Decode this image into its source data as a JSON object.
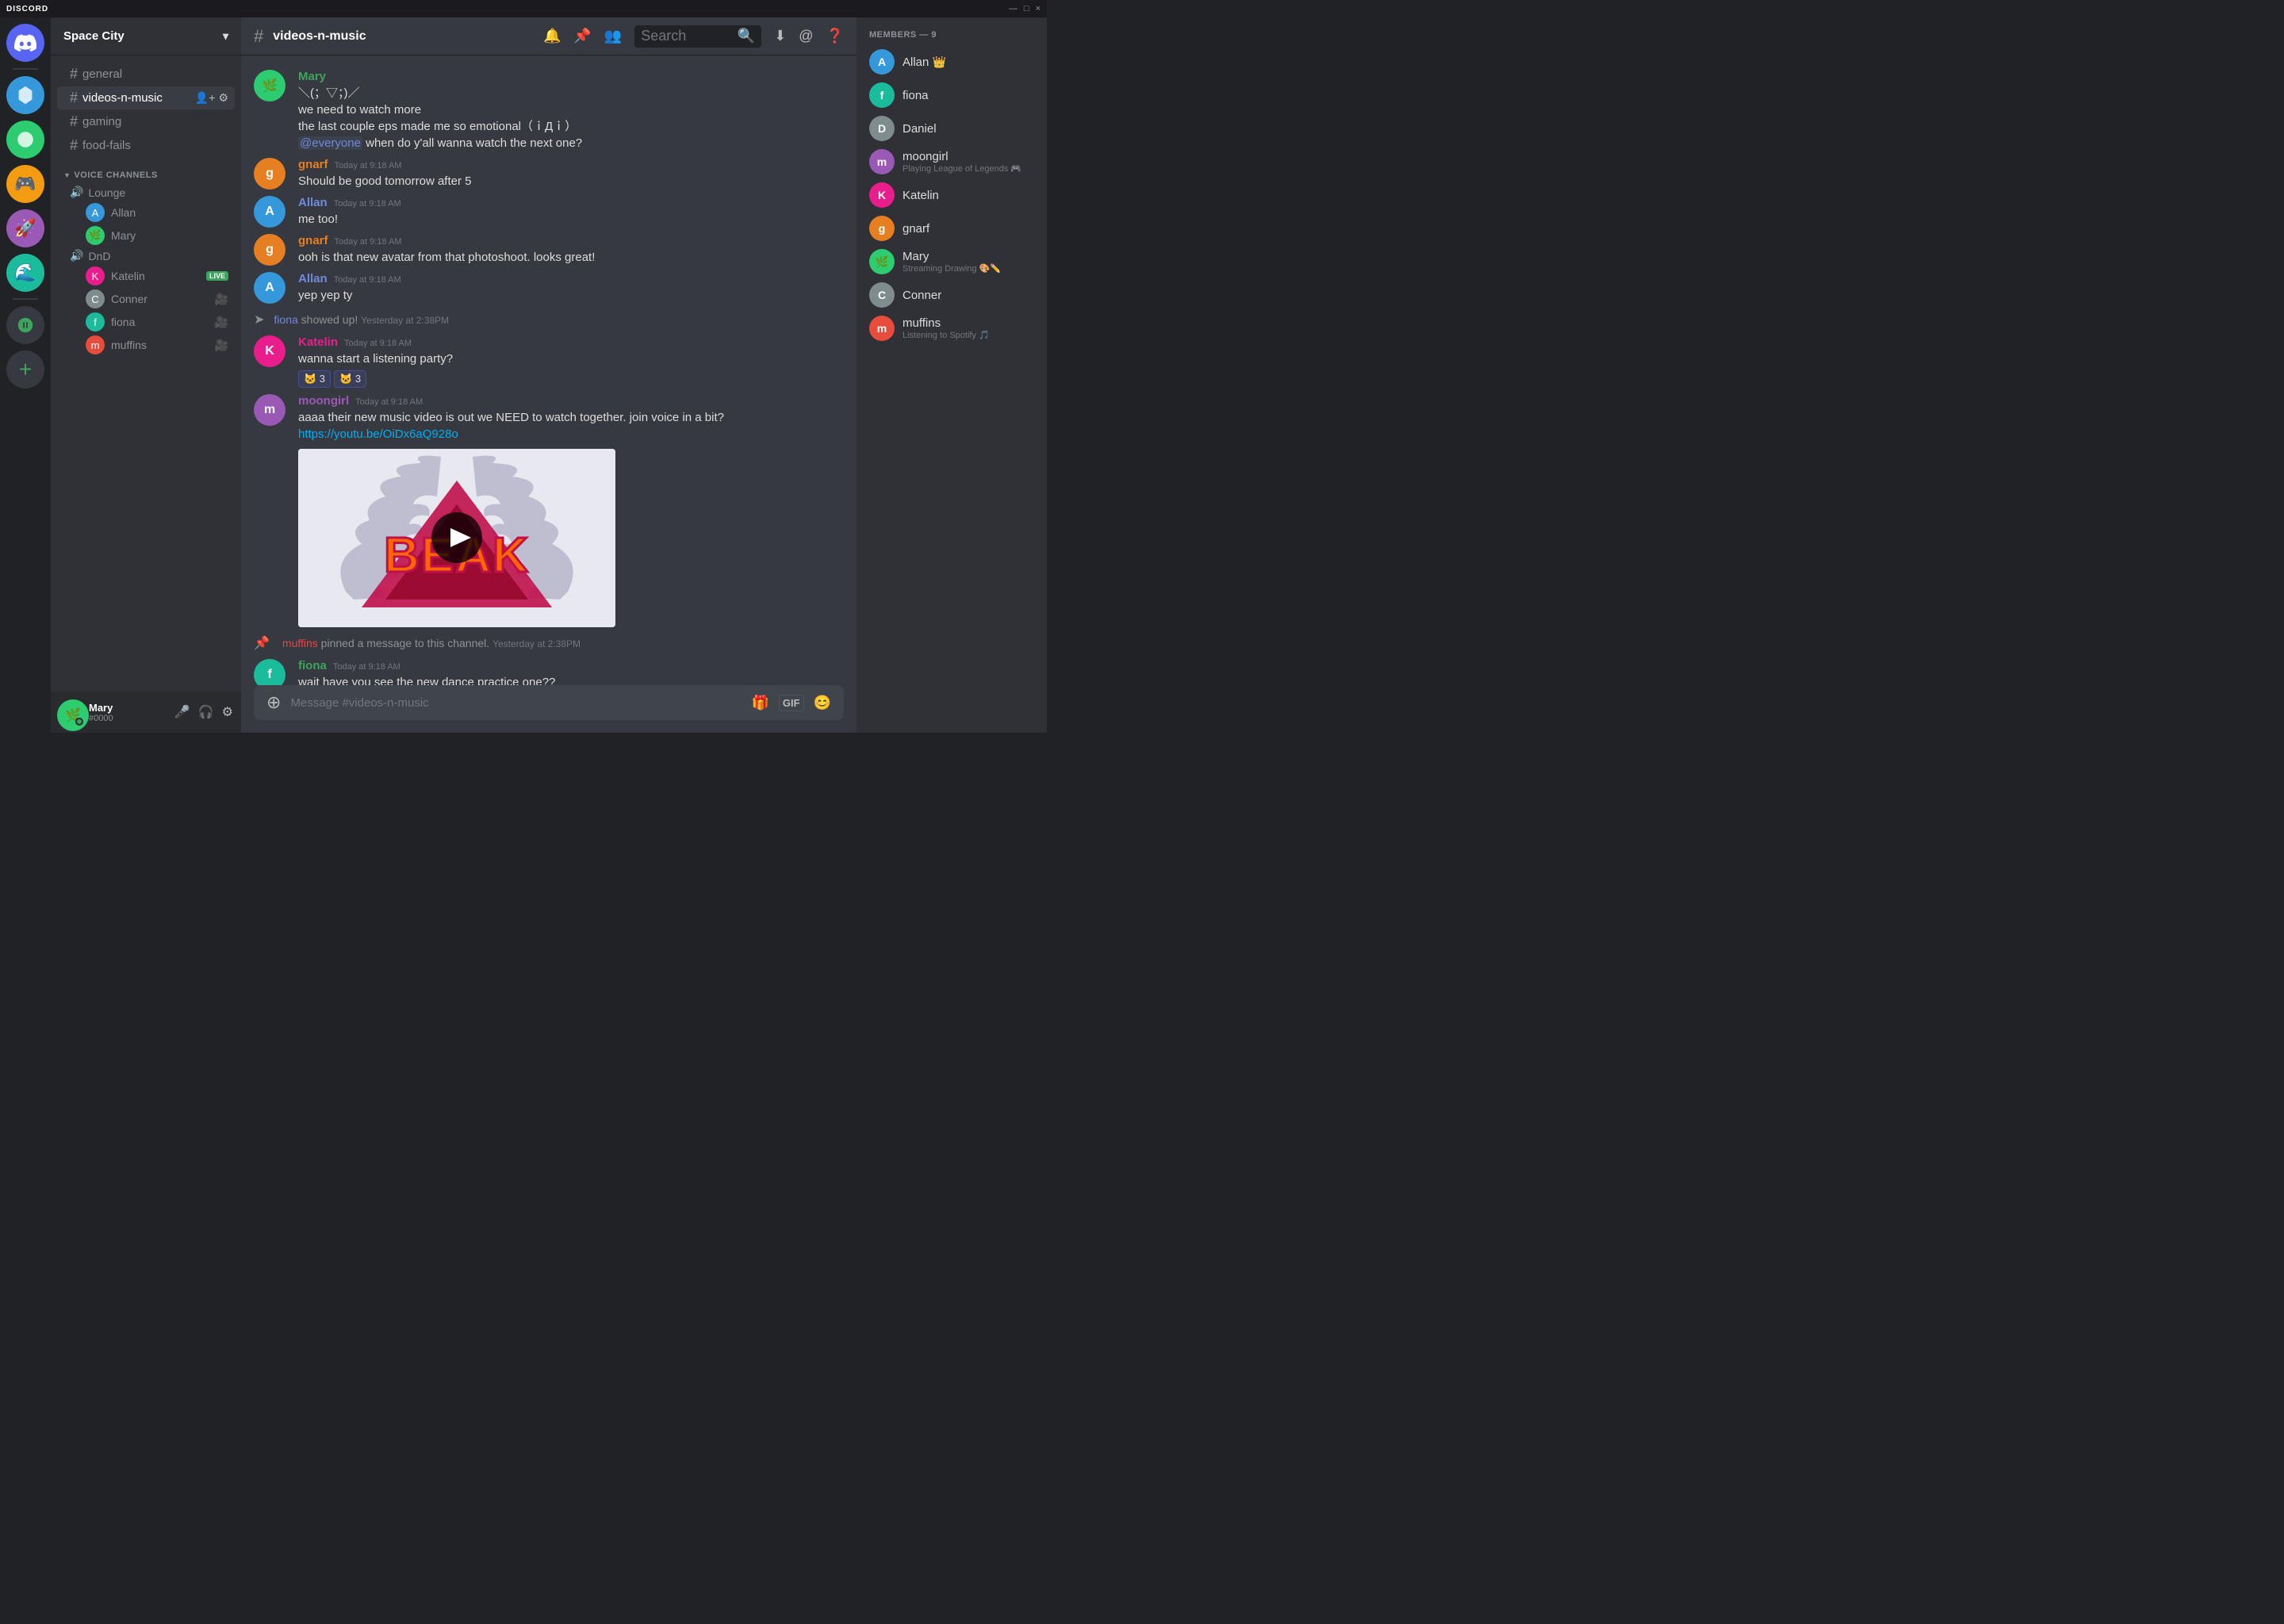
{
  "titlebar": {
    "logo": "DISCORD",
    "controls": [
      "—",
      "□",
      "×"
    ]
  },
  "server": {
    "name": "Space City",
    "channels": [
      {
        "type": "text",
        "name": "general",
        "active": false
      },
      {
        "type": "text",
        "name": "videos-n-music",
        "active": true
      },
      {
        "type": "text",
        "name": "gaming",
        "active": false
      },
      {
        "type": "text",
        "name": "food-fails",
        "active": false
      }
    ],
    "voice": {
      "label": "Voice Channels",
      "groups": [
        {
          "name": "Lounge",
          "users": [
            {
              "name": "Allan",
              "color": "av-blue"
            },
            {
              "name": "Mary",
              "color": "av-green"
            }
          ]
        },
        {
          "name": "DnD",
          "users": [
            {
              "name": "Katelin",
              "live": true,
              "color": "av-pink"
            },
            {
              "name": "Conner",
              "video": true,
              "color": "av-grey"
            },
            {
              "name": "fiona",
              "video": true,
              "color": "av-teal"
            },
            {
              "name": "muffins",
              "video": true,
              "color": "av-red"
            }
          ]
        }
      ]
    }
  },
  "currentChannel": "videos-n-music",
  "search": {
    "placeholder": "Search"
  },
  "messages": [
    {
      "id": "msg1",
      "author": "Mary",
      "authorColor": "msg-fiona",
      "avatarColor": "av-green",
      "avatarEmoji": "🌿",
      "showAvatar": true,
      "lines": [
        "＼(；▽；)／",
        "we need to watch more",
        "the last couple eps made me so emotional（ｉДｉ）"
      ],
      "mention": "@everyone",
      "mentionSuffix": " when do y'all wanna watch the next one?"
    },
    {
      "id": "msg2",
      "author": "gnarf",
      "authorColor": "msg-gnarf",
      "avatarColor": "av-orange",
      "timestamp": "Today at 9:18 AM",
      "showAvatar": true,
      "text": "Should be good tomorrow after 5"
    },
    {
      "id": "msg3",
      "author": "Allan",
      "authorColor": "msg-allan",
      "avatarColor": "av-blue",
      "timestamp": "Today at 9:18 AM",
      "showAvatar": true,
      "text": "me too!"
    },
    {
      "id": "msg4",
      "author": "gnarf",
      "authorColor": "msg-gnarf",
      "avatarColor": "av-orange",
      "timestamp": "Today at 9:18 AM",
      "showAvatar": true,
      "text": "ooh is that new avatar from that photoshoot. looks great!"
    },
    {
      "id": "msg5",
      "author": "Allan",
      "authorColor": "msg-allan",
      "avatarColor": "av-blue",
      "timestamp": "Today at 9:18 AM",
      "showAvatar": true,
      "text": "yep yep ty"
    },
    {
      "id": "msg6",
      "author": "fiona",
      "authorColor": "msg-fiona",
      "avatarColor": "av-teal",
      "showAvatar": true,
      "system": true,
      "systemText": "fiona",
      "systemAction": " showed up!",
      "systemTimestamp": "Yesterday at 2:38PM"
    },
    {
      "id": "msg7",
      "author": "Katelin",
      "authorColor": "msg-katelin",
      "avatarColor": "av-pink",
      "timestamp": "Today at 9:18 AM",
      "showAvatar": true,
      "text": "wanna start a listening party?",
      "reactions": [
        {
          "emoji": "🐱",
          "count": 3
        },
        {
          "emoji": "🐱",
          "count": 3
        }
      ]
    },
    {
      "id": "msg8",
      "author": "moongirl",
      "authorColor": "msg-moongirl",
      "avatarColor": "av-purple",
      "timestamp": "Today at 9:18 AM",
      "showAvatar": true,
      "text": "aaaa their new music video is out we NEED to watch together. join voice in a bit?",
      "link": "https://youtu.be/OiDx6aQ928o",
      "hasVideo": true
    },
    {
      "id": "system1",
      "type": "system",
      "actor": "muffins",
      "action": " pinned a message to this channel.",
      "timestamp": "Yesterday at 2:38PM"
    },
    {
      "id": "msg9",
      "author": "fiona",
      "authorColor": "msg-fiona",
      "avatarColor": "av-teal",
      "timestamp": "Today at 9:18 AM",
      "showAvatar": true,
      "text": "wait have you see the new dance practice one??"
    }
  ],
  "members": {
    "header": "Members — 9",
    "list": [
      {
        "name": "Allan",
        "emoji": "👑",
        "color": "av-blue",
        "emojiCrown": true
      },
      {
        "name": "fiona",
        "color": "av-teal"
      },
      {
        "name": "Daniel",
        "color": "av-grey"
      },
      {
        "name": "moongirl",
        "color": "av-purple",
        "status": "Playing League of Legends 🎮"
      },
      {
        "name": "Katelin",
        "color": "av-pink"
      },
      {
        "name": "gnarf",
        "color": "av-orange"
      },
      {
        "name": "Mary",
        "color": "av-green",
        "status": "Streaming Drawing 🎨✏️"
      },
      {
        "name": "Conner",
        "color": "av-grey"
      },
      {
        "name": "muffins",
        "color": "av-red",
        "status": "Listening to Spotify 🎵"
      }
    ]
  },
  "user": {
    "name": "Mary",
    "discriminator": "#0000",
    "color": "av-green",
    "avatarEmoji": "🌿"
  },
  "input": {
    "placeholder": "Message #videos-n-music"
  }
}
